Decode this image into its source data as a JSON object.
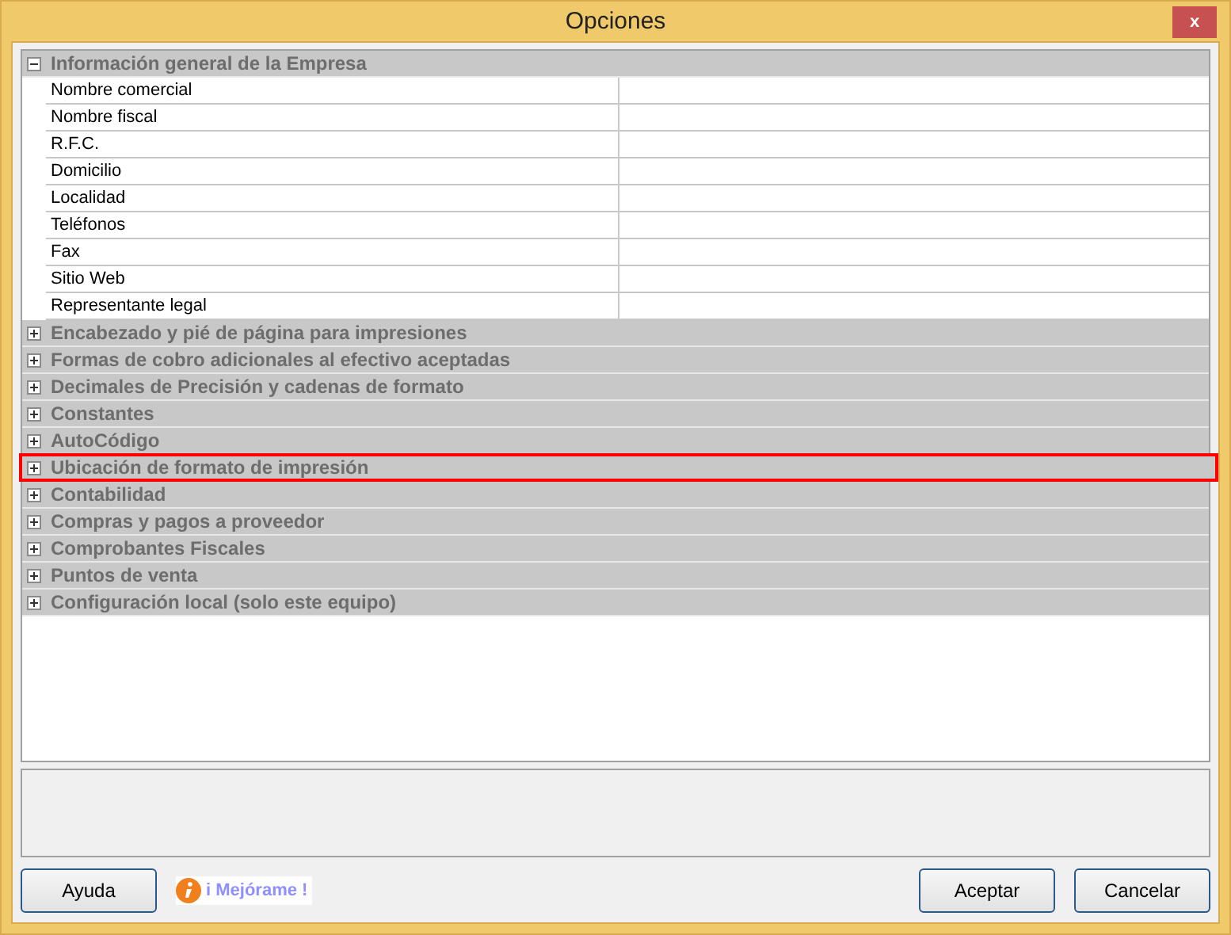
{
  "window": {
    "title": "Opciones",
    "close": "x"
  },
  "categories": [
    {
      "label": "Información general de la Empresa",
      "expanded": true,
      "highlighted": false,
      "properties": [
        {
          "name": "Nombre comercial"
        },
        {
          "name": "Nombre fiscal"
        },
        {
          "name": "R.F.C."
        },
        {
          "name": "Domicilio"
        },
        {
          "name": "Localidad"
        },
        {
          "name": "Teléfonos"
        },
        {
          "name": "Fax"
        },
        {
          "name": "Sitio Web"
        },
        {
          "name": "Representante legal"
        }
      ]
    },
    {
      "label": "Encabezado y pié de página para impresiones",
      "expanded": false,
      "highlighted": false
    },
    {
      "label": "Formas de cobro adicionales al efectivo aceptadas",
      "expanded": false,
      "highlighted": false
    },
    {
      "label": "Decimales de Precisión y cadenas de formato",
      "expanded": false,
      "highlighted": false
    },
    {
      "label": "Constantes",
      "expanded": false,
      "highlighted": false
    },
    {
      "label": "AutoCódigo",
      "expanded": false,
      "highlighted": false
    },
    {
      "label": "Ubicación de formato de impresión",
      "expanded": false,
      "highlighted": true
    },
    {
      "label": "Contabilidad",
      "expanded": false,
      "highlighted": false
    },
    {
      "label": "Compras y pagos a proveedor",
      "expanded": false,
      "highlighted": false
    },
    {
      "label": "Comprobantes Fiscales",
      "expanded": false,
      "highlighted": false
    },
    {
      "label": "Puntos de venta",
      "expanded": false,
      "highlighted": false
    },
    {
      "label": "Configuración local (solo este equipo)",
      "expanded": false,
      "highlighted": false
    }
  ],
  "buttons": {
    "help": "Ayuda",
    "improve": "i Mejórame !",
    "ok": "Aceptar",
    "cancel": "Cancelar"
  }
}
